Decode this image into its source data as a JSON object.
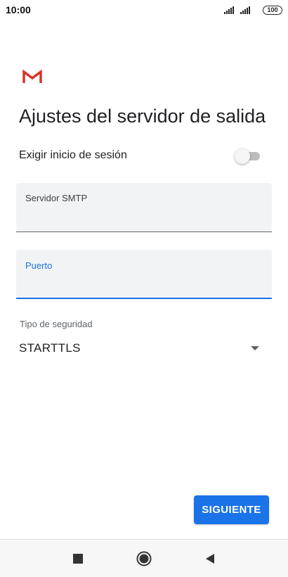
{
  "status_bar": {
    "time": "10:00",
    "battery": "100"
  },
  "app": {
    "logo_icon": "gmail-logo-icon",
    "brand_color": "#d93025"
  },
  "page": {
    "title": "Ajustes del servidor de salida"
  },
  "login_toggle": {
    "label": "Exigir inicio de sesión",
    "state": "off"
  },
  "fields": {
    "smtp": {
      "label": "Servidor SMTP",
      "value": ""
    },
    "port": {
      "label": "Puerto",
      "value": ""
    }
  },
  "security": {
    "label": "Tipo de seguridad",
    "selected": "STARTTLS"
  },
  "actions": {
    "next_label": "SIGUIENTE"
  },
  "nav": {
    "recents_icon": "square-icon",
    "home_icon": "circle-icon",
    "back_icon": "triangle-back-icon"
  },
  "colors": {
    "accent": "#1a73e8",
    "field_bg": "#f1f3f4"
  }
}
